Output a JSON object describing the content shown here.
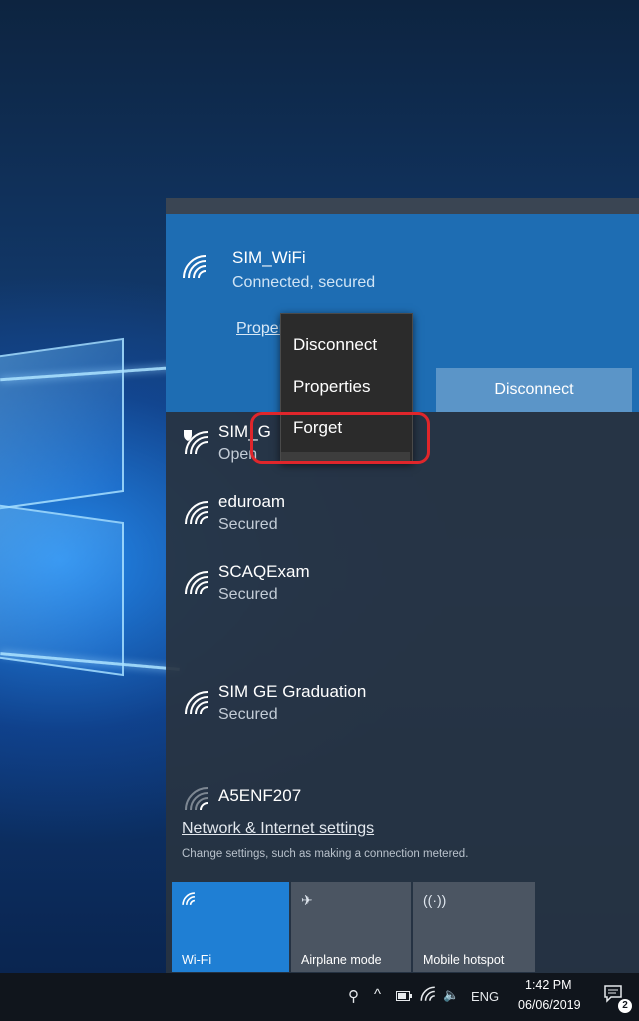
{
  "connected_network": {
    "name": "SIM_WiFi",
    "status": "Connected, secured",
    "properties_link": "Properties",
    "disconnect_label": "Disconnect"
  },
  "context_menu": {
    "items": [
      {
        "label": "Disconnect"
      },
      {
        "label": "Properties"
      },
      {
        "label": "Forget"
      }
    ]
  },
  "networks": [
    {
      "name": "SIM_G",
      "status": "Open",
      "icon": "wifi-shield-icon"
    },
    {
      "name": "eduroam",
      "status": "Secured",
      "icon": "wifi-icon"
    },
    {
      "name": "SCAQExam",
      "status": "Secured",
      "icon": "wifi-icon"
    },
    {
      "name": "SIM GE Graduation",
      "status": "Secured",
      "icon": "wifi-icon"
    },
    {
      "name": "A5ENF207",
      "status": "",
      "icon": "wifi-weak-icon"
    }
  ],
  "settings": {
    "link": "Network & Internet settings",
    "description": "Change settings, such as making a connection metered."
  },
  "quick_actions": [
    {
      "label": "Wi-Fi",
      "icon": "wifi-icon",
      "active": true
    },
    {
      "label": "Airplane mode",
      "icon": "airplane-icon",
      "active": false
    },
    {
      "label": "Mobile hotspot",
      "icon": "hotspot-icon",
      "active": false
    }
  ],
  "taskbar": {
    "language": "ENG",
    "time": "1:42 PM",
    "date": "06/06/2019",
    "notification_count": "2"
  },
  "colors": {
    "accent": "#1f7fd4",
    "connected_panel": "#1e6db3",
    "highlight": "#e0262b"
  }
}
